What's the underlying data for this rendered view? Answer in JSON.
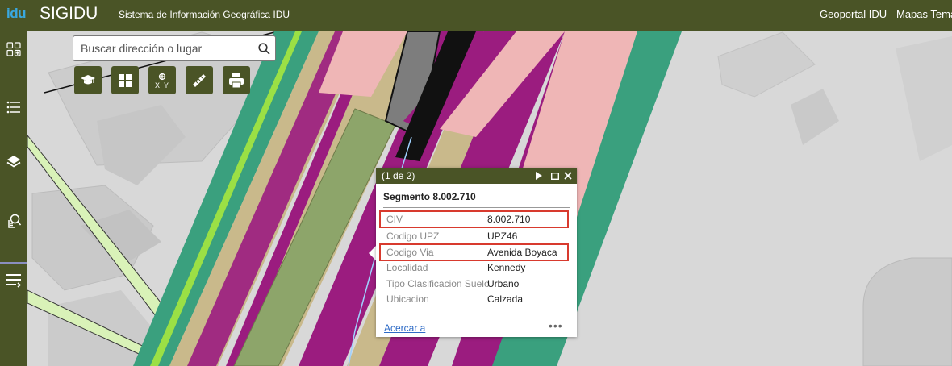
{
  "header": {
    "logo": "idu",
    "title": "SIGIDU",
    "subtitle": "Sistema de Información Geográfica IDU",
    "links": [
      "Geoportal IDU",
      "Mapas Temát"
    ]
  },
  "sidebar": {
    "items": [
      {
        "name": "widgets",
        "icon": "grid-icon"
      },
      {
        "name": "legend",
        "icon": "list-icon"
      },
      {
        "name": "layers",
        "icon": "layers-icon"
      },
      {
        "name": "query",
        "icon": "document-search-icon"
      },
      {
        "name": "menu",
        "icon": "menu-icon"
      }
    ]
  },
  "search": {
    "placeholder": "Buscar dirección o lugar",
    "icon": "search-icon"
  },
  "toolbar": {
    "tools": [
      {
        "name": "measure-education",
        "icon": "graduation-cap-icon"
      },
      {
        "name": "basemap",
        "icon": "grid-icon"
      },
      {
        "name": "coordinates",
        "icon": "xy-coordinates-icon"
      },
      {
        "name": "measure",
        "icon": "ruler-icon"
      },
      {
        "name": "print",
        "icon": "printer-icon"
      }
    ]
  },
  "popup": {
    "counter": "(1 de 2)",
    "title": "Segmento 8.002.710",
    "attributes": [
      {
        "label": "CIV",
        "value": "8.002.710",
        "highlighted": true
      },
      {
        "label": "Codigo UPZ",
        "value": "UPZ46",
        "highlighted": false
      },
      {
        "label": "Codigo Via",
        "value": "Avenida Boyaca",
        "highlighted": true
      },
      {
        "label": "Localidad",
        "value": "Kennedy",
        "highlighted": false
      },
      {
        "label": "Tipo Clasificacion Suelo",
        "value": "Urbano",
        "highlighted": false
      },
      {
        "label": "Ubicacion",
        "value": "Calzada",
        "highlighted": false
      }
    ],
    "zoom_link": "Acercar a",
    "more": "•••"
  },
  "colors": {
    "brand": "#4a5426",
    "highlight": "#d83a2e",
    "link": "#2e6bc6",
    "map_green": "#3aa07e",
    "map_magenta": "#9b1c7f",
    "map_pink": "#efb6b6",
    "map_tan": "#c9b98b"
  }
}
